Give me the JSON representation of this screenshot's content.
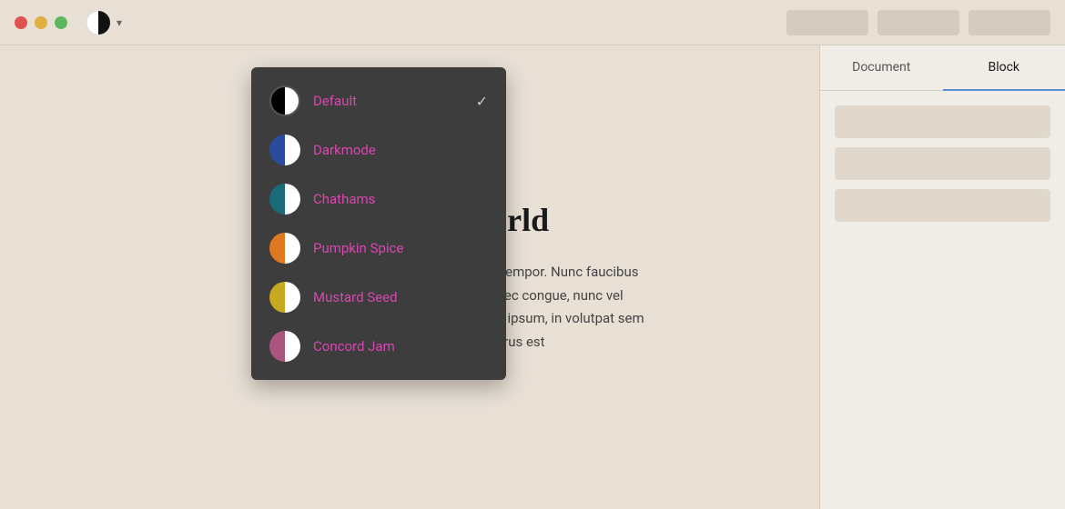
{
  "topbar": {
    "traffic_lights": [
      "red",
      "yellow",
      "green"
    ],
    "logo_text": "",
    "dropdown_arrow": "▾",
    "buttons": [
      "",
      "",
      ""
    ]
  },
  "dropdown": {
    "themes": [
      {
        "id": "default",
        "label": "Default",
        "icon_class": "icon-default",
        "selected": true
      },
      {
        "id": "darkmode",
        "label": "Darkmode",
        "icon_class": "icon-darkmode",
        "selected": false
      },
      {
        "id": "chathams",
        "label": "Chathams",
        "icon_class": "icon-chathams",
        "selected": false
      },
      {
        "id": "pumpkin-spice",
        "label": "Pumpkin Spice",
        "icon_class": "icon-pumpkin",
        "selected": false
      },
      {
        "id": "mustard-seed",
        "label": "Mustard Seed",
        "icon_class": "icon-mustard",
        "selected": false
      },
      {
        "id": "concord-jam",
        "label": "Concord Jam",
        "icon_class": "icon-concord",
        "selected": false
      }
    ]
  },
  "content": {
    "title": "Hello World",
    "body": "Aenean sed nibh a magna posuere tempor. Nunc faucibus pellentesque nunc in aliquet. Donec congue, nunc vel tempor congue, enim sapien lobortis ipsum, in volutpat sem ex in ligula. Nunc purus est"
  },
  "sidebar": {
    "tabs": [
      {
        "id": "document",
        "label": "Document",
        "active": false
      },
      {
        "id": "block",
        "label": "Block",
        "active": true
      }
    ]
  }
}
